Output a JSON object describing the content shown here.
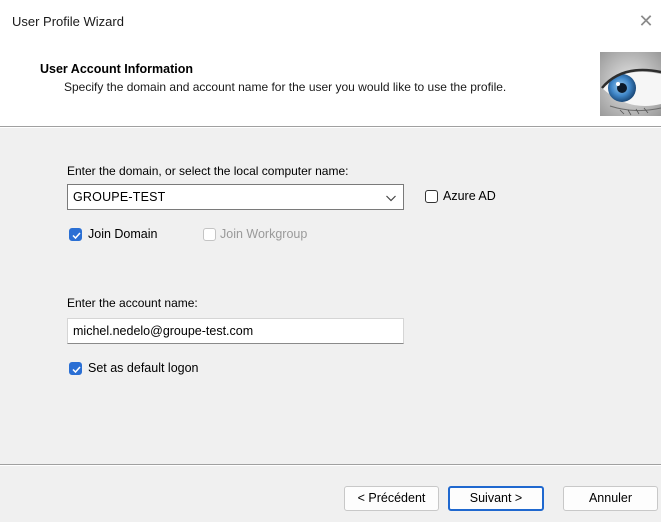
{
  "window": {
    "title": "User Profile Wizard"
  },
  "header": {
    "title": "User Account Information",
    "subtitle": "Specify the domain and account name for the user you would like to use the profile."
  },
  "domain": {
    "label": "Enter the domain, or select the local computer name:",
    "value": "GROUPE-TEST",
    "azure_ad": {
      "label": "Azure AD",
      "checked": false
    },
    "join_domain": {
      "label": "Join Domain",
      "checked": true
    },
    "join_workgroup": {
      "label": "Join Workgroup",
      "checked": false,
      "disabled": true
    }
  },
  "account": {
    "label": "Enter the account name:",
    "value": "michel.nedelo@groupe-test.com",
    "default_logon": {
      "label": "Set as default logon",
      "checked": true
    }
  },
  "buttons": {
    "back": "< Précédent",
    "next": "Suivant >",
    "cancel": "Annuler"
  },
  "colors": {
    "accent": "#2a6fd4",
    "dialog_bg": "#f0f0f0"
  },
  "icons": {
    "close": "close-icon",
    "eye": "eye-image",
    "dropdown": "chevron-down-icon",
    "check": "checkmark-icon"
  }
}
